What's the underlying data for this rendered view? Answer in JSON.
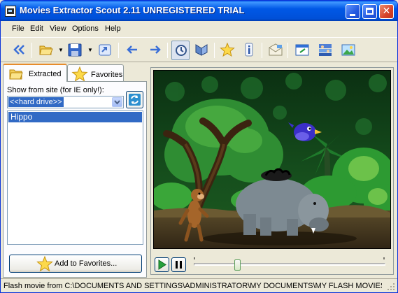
{
  "window": {
    "title": "Movies Extractor Scout 2.11 UNREGISTERED TRIAL"
  },
  "menu": [
    "File",
    "Edit",
    "View",
    "Options",
    "Help"
  ],
  "toolbar": {
    "icons": [
      "collapse-panel-icon",
      "open-folder-icon",
      "save-icon",
      "export-icon",
      "back-arrow-icon",
      "forward-arrow-icon",
      "refresh-scan-icon",
      "play-movie-icon",
      "favorites-star-icon",
      "info-icon",
      "email-icon",
      "window-icon",
      "people-icon",
      "picture-icon"
    ]
  },
  "tabs": {
    "extracted": "Extracted",
    "favorites": "Favorites",
    "active": "extracted"
  },
  "left_panel": {
    "site_label": "Show from site (for IE only!):",
    "site_selected": "<<hard drive>>",
    "movies": [
      "Hippo"
    ],
    "selected_movie": "Hippo",
    "add_favorites": "Add to Favorites..."
  },
  "player": {
    "movie_title": "Hippo",
    "seek_position": 0.22
  },
  "status": {
    "text": "Flash movie from C:\\DOCUMENTS AND SETTINGS\\ADMINISTRATOR\\MY DOCUMENTS\\MY FLASH MOVIES\\HIPPO.SWF"
  },
  "colors": {
    "title_bar": "#0054e3",
    "selection": "#316ac5",
    "jungle_dark": "#0d3a16",
    "hippo": "#7d8a92"
  }
}
